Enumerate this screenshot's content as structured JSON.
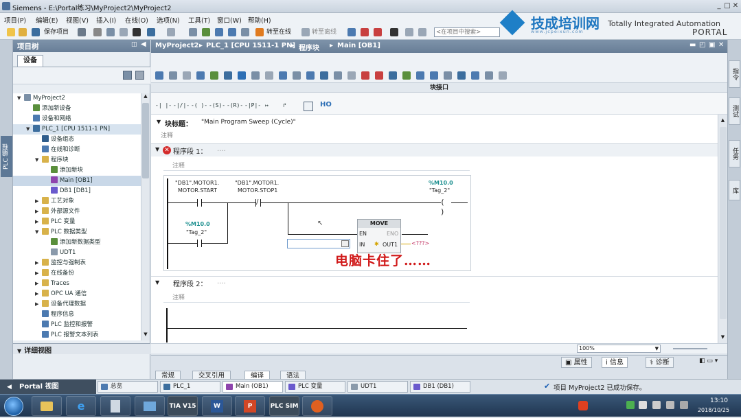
{
  "window": {
    "title": "Siemens  -  E:\\Portal练习\\MyProject2\\MyProject2",
    "minimize": "_",
    "maximize": "□",
    "close": "✕"
  },
  "menu": [
    "项目(P)",
    "编辑(E)",
    "视图(V)",
    "插入(I)",
    "在线(O)",
    "选项(N)",
    "工具(T)",
    "窗口(W)",
    "帮助(H)"
  ],
  "toolbar": {
    "save_project": "保存项目",
    "go_online": "转至在线",
    "go_offline": "转至离线",
    "search_placeholder": "<在项目中搜索>"
  },
  "branding": {
    "logo_text": "技成培训网",
    "logo_url": "www.jcpeixun.com",
    "tia_line1": "Totally Integrated Automation",
    "tia_line2": "PORTAL"
  },
  "left_rail": {
    "tab": "PLC 编程"
  },
  "project_tree": {
    "title": "项目树",
    "tab": "设备",
    "items": [
      {
        "label": "MyProject2",
        "level": 0,
        "expander": "▼",
        "icon": "project-icon",
        "color": "#7a8fa6"
      },
      {
        "label": "添加新设备",
        "level": 1,
        "expander": "",
        "icon": "add-device-icon",
        "color": "#5a8f3c"
      },
      {
        "label": "设备和网络",
        "level": 1,
        "expander": "",
        "icon": "network-icon",
        "color": "#4c7ab0"
      },
      {
        "label": "PLC_1 [CPU 1511-1 PN]",
        "level": 1,
        "expander": "▼",
        "icon": "cpu-icon",
        "color": "#3c6e9e",
        "selected": true
      },
      {
        "label": "设备组态",
        "level": 2,
        "expander": "",
        "icon": "device-config-icon",
        "color": "#2f5d8c"
      },
      {
        "label": "在线和诊断",
        "level": 2,
        "expander": "",
        "icon": "diagnostics-icon",
        "color": "#4c7ab0"
      },
      {
        "label": "程序块",
        "level": 2,
        "expander": "▼",
        "icon": "folder-icon",
        "color": "#d8b24a"
      },
      {
        "label": "添加新块",
        "level": 3,
        "expander": "",
        "icon": "add-block-icon",
        "color": "#5a8f3c"
      },
      {
        "label": "Main [OB1]",
        "level": 3,
        "expander": "",
        "icon": "ob-icon",
        "color": "#8e44ad",
        "highlight": true
      },
      {
        "label": "DB1 [DB1]",
        "level": 3,
        "expander": "",
        "icon": "db-icon",
        "color": "#6a5acd"
      },
      {
        "label": "工艺对象",
        "level": 2,
        "expander": "▶",
        "icon": "folder-icon",
        "color": "#d8b24a"
      },
      {
        "label": "外部源文件",
        "level": 2,
        "expander": "▶",
        "icon": "folder-icon",
        "color": "#d8b24a"
      },
      {
        "label": "PLC 变量",
        "level": 2,
        "expander": "▶",
        "icon": "folder-icon",
        "color": "#d8b24a"
      },
      {
        "label": "PLC 数据类型",
        "level": 2,
        "expander": "▼",
        "icon": "folder-icon",
        "color": "#d8b24a"
      },
      {
        "label": "添加新数据类型",
        "level": 3,
        "expander": "",
        "icon": "add-type-icon",
        "color": "#5a8f3c"
      },
      {
        "label": "UDT1",
        "level": 3,
        "expander": "",
        "icon": "udt-icon",
        "color": "#8a9aab"
      },
      {
        "label": "监控与强制表",
        "level": 2,
        "expander": "▶",
        "icon": "folder-icon",
        "color": "#d8b24a"
      },
      {
        "label": "在线备份",
        "level": 2,
        "expander": "▶",
        "icon": "folder-icon",
        "color": "#d8b24a"
      },
      {
        "label": "Traces",
        "level": 2,
        "expander": "▶",
        "icon": "folder-icon",
        "color": "#d8b24a"
      },
      {
        "label": "OPC UA 通信",
        "level": 2,
        "expander": "▶",
        "icon": "folder-icon",
        "color": "#d8b24a"
      },
      {
        "label": "设备代理数据",
        "level": 2,
        "expander": "▶",
        "icon": "folder-icon",
        "color": "#d8b24a"
      },
      {
        "label": "程序信息",
        "level": 2,
        "expander": "",
        "icon": "program-info-icon",
        "color": "#4c7ab0"
      },
      {
        "label": "PLC 监控和报警",
        "level": 2,
        "expander": "",
        "icon": "alarm-icon",
        "color": "#4c7ab0"
      },
      {
        "label": "PLC 报警文本列表",
        "level": 2,
        "expander": "",
        "icon": "text-list-icon",
        "color": "#4c7ab0"
      }
    ],
    "detail_view": "详细视图"
  },
  "editor": {
    "breadcrumb": [
      "MyProject2",
      "PLC_1 [CPU 1511-1 PN]",
      "程序块",
      "Main [OB1]"
    ],
    "interface_label": "块接口",
    "instructions": [
      "-| |-",
      "-|/|-",
      "-( )-",
      "-(S)-",
      "-(R)-",
      "-|P|-",
      "↦",
      "↱"
    ],
    "block_title_label": "块标题：",
    "block_title": "\"Main Program Sweep (Cycle)\"",
    "comment": "注释",
    "network1": {
      "label": "程序段 1：",
      "dots": "....",
      "comment": "注释",
      "contact1_operand": "\"DB1\".MOTOR1.",
      "contact1_member": "MOTOR.START",
      "contact2_operand": "\"DB1\".MOTOR1.",
      "contact2_member": "MOTOR.STOP1",
      "coil_address": "%M10.0",
      "coil_tag": "\"Tag_2\"",
      "parallel_address": "%M10.0",
      "parallel_tag": "\"Tag_2\"",
      "move_title": "MOVE",
      "move_en": "EN",
      "move_eno": "ENO",
      "move_in": "IN",
      "move_out": "OUT1",
      "move_out_value": "<???>",
      "overlay": "电脑卡住了……"
    },
    "network2": {
      "label": "程序段 2：",
      "dots": "....",
      "comment": "注释"
    }
  },
  "zoom": "100%",
  "inspector_tabs": [
    "属性",
    "信息",
    "诊断"
  ],
  "bottom_tabs": [
    "常规",
    "交叉引用",
    "编译",
    "语法"
  ],
  "right_rail": [
    "指令",
    "测试",
    "任务",
    "库"
  ],
  "portal_bar": {
    "portal_view": "Portal 视图",
    "tabs": [
      {
        "label": "总览",
        "color": "#4c7ab0"
      },
      {
        "label": "PLC_1",
        "color": "#3c6e9e"
      },
      {
        "label": "Main (OB1)",
        "color": "#8e44ad"
      },
      {
        "label": "PLC 变量",
        "color": "#6a5acd"
      },
      {
        "label": "UDT1",
        "color": "#8a9aab"
      },
      {
        "label": "DB1 (DB1)",
        "color": "#6a5acd"
      }
    ],
    "status": "项目 MyProject2 已成功保存。"
  },
  "taskbar": {
    "apps": [
      "explorer",
      "IE",
      "calc",
      "photo",
      "TIA V15",
      "W",
      "P",
      "PLC SIM",
      "bird"
    ],
    "tia_label": "TIA V15",
    "plcsim_label": "PLC SIM",
    "time": "13:10",
    "date": "2018/10/25"
  }
}
